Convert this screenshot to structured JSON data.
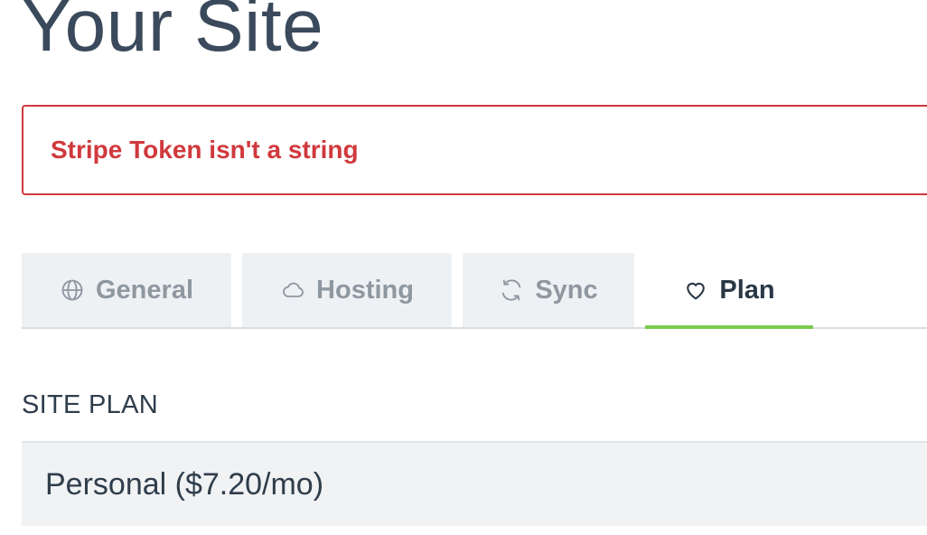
{
  "page": {
    "title": "Your Site"
  },
  "alert": {
    "message": "Stripe Token isn't a string",
    "color": "#d0393d"
  },
  "tabs": [
    {
      "label": "General",
      "icon": "globe-icon",
      "active": false
    },
    {
      "label": "Hosting",
      "icon": "cloud-icon",
      "active": false
    },
    {
      "label": "Sync",
      "icon": "sync-icon",
      "active": false
    },
    {
      "label": "Plan",
      "icon": "heart-icon",
      "active": true
    }
  ],
  "colors": {
    "active_tab_indicator": "#7ccc4c",
    "inactive_tab_background": "#eef1f4"
  },
  "plan": {
    "section_label": "SITE PLAN",
    "selected_value": "Personal ($7.20/mo)"
  }
}
